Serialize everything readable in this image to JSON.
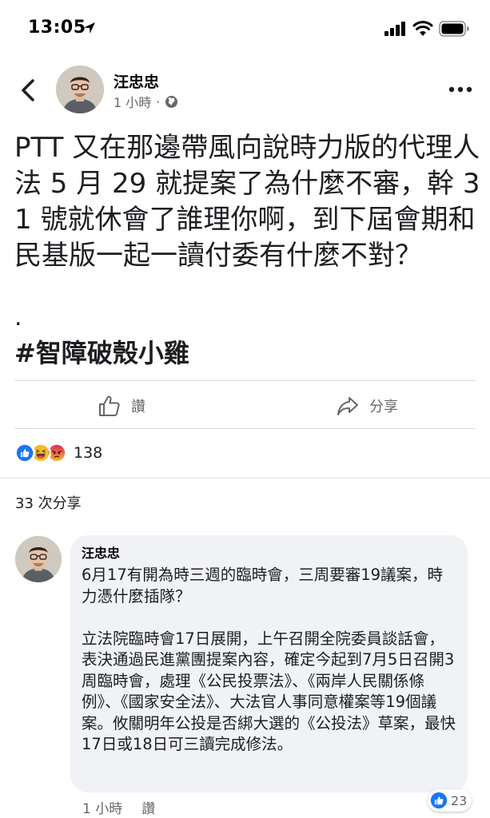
{
  "status_bar": {
    "time": "13:05",
    "icons": [
      "location-arrow-icon",
      "signal-icon",
      "wifi-icon",
      "battery-icon"
    ]
  },
  "post": {
    "author": "汪忠忠",
    "time": "1 小時",
    "meta_separator": "·",
    "privacy_icon": "globe-icon",
    "text": "PTT 又在那邊帶風向說時力版的代理人法 5 月 29 就提案了為什麼不審，幹 31 號就休會了誰理你啊，到下屆會期和民基版一起一讀付委有什麼不對？",
    "dot": ".",
    "hashtag": "#智障破殼小雞"
  },
  "actions": {
    "like_label": "讚",
    "share_label": "分享"
  },
  "reactions": {
    "types": [
      "like",
      "haha",
      "angry"
    ],
    "count": "138"
  },
  "shares": {
    "label": "33 次分享"
  },
  "comment": {
    "author": "汪忠忠",
    "text": "6月17有開為時三週的臨時會，三周要審19議案，時力憑什麼插隊？\n\n立法院臨時會17日展開，上午召開全院委員談話會，表決通過民進黨團提案內容，確定今起到7月5日召開3周臨時會，處理《公民投票法》、《兩岸人民關係條例》、《國家安全法》、大法官人事同意權案等19個議案。攸關明年公投是否綁大選的《公投法》草案，最快17日或18日可三讀完成修法。",
    "time": "1 小時",
    "like_label": "讚",
    "likes": "23"
  },
  "colors": {
    "text": "#1c1e21",
    "secondary_text": "#65676b",
    "like_blue": "#1877f2",
    "angry_red": "#f0603c",
    "haha_yellow": "#f7b928",
    "bubble_bg": "#f0f2f5",
    "divider": "#dadde1"
  }
}
